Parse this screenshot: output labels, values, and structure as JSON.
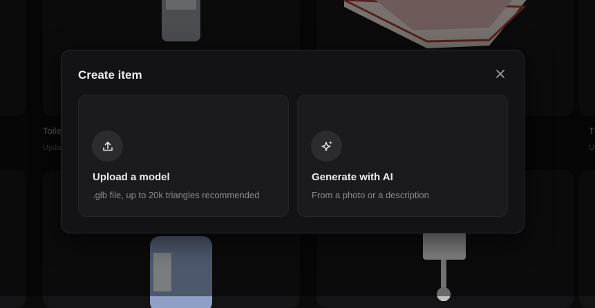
{
  "background": {
    "items": [
      {
        "name": "Toile",
        "sub": "Upda"
      },
      {
        "name": "T",
        "sub": "U"
      }
    ]
  },
  "dialog": {
    "title": "Create item",
    "close_icon": "close-icon",
    "options": [
      {
        "icon": "upload-icon",
        "title": "Upload a model",
        "description": ".glb file, up to 20k triangles recommended"
      },
      {
        "icon": "sparkles-icon",
        "title": "Generate with AI",
        "description": "From a photo or a description"
      }
    ]
  },
  "colors": {
    "background": "#0b0b0c",
    "dialog": "#131315",
    "option_card": "#1b1b1e",
    "icon_circle": "#2c2c30"
  }
}
